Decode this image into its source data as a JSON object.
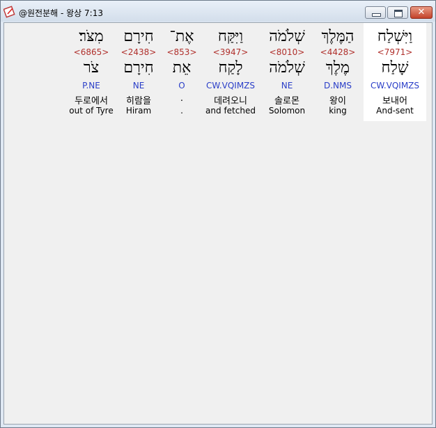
{
  "window": {
    "title": "@원전분해 - 왕상 7:13",
    "close_glyph": "✕"
  },
  "words": [
    {
      "hebrew": "מִצֹּר׃",
      "strong": "<6865>",
      "lemma": "צֹר",
      "parse": "P.NE",
      "korean": "두로에서",
      "english": "out of Tyre"
    },
    {
      "hebrew": "חִירָם",
      "strong": "<2438>",
      "lemma": "חִירָם",
      "parse": "NE",
      "korean": "히람을",
      "english": "Hiram"
    },
    {
      "hebrew": "אֶת־",
      "strong": "<853>",
      "lemma": "אֵת",
      "parse": "O",
      "korean": ".",
      "english": "."
    },
    {
      "hebrew": "וַיִּקַּח",
      "strong": "<3947>",
      "lemma": "לָקַח",
      "parse": "CW.VQIMZS",
      "korean": "데려오니",
      "english": "and fetched"
    },
    {
      "hebrew": "שְׁלֹמֹה",
      "strong": "<8010>",
      "lemma": "שְׁלֹמֹה",
      "parse": "NE",
      "korean": "솔로몬",
      "english": "Solomon"
    },
    {
      "hebrew": "הַמֶּלֶךְ",
      "strong": "<4428>",
      "lemma": "מֶלֶךְ",
      "parse": "D.NMS",
      "korean": "왕이",
      "english": "king"
    },
    {
      "hebrew": "וַיִּשְׁלַח",
      "strong": "<7971>",
      "lemma": "שָׁלַח",
      "parse": "CW.VQIMZS",
      "korean": "보내어",
      "english": "And-sent"
    }
  ]
}
